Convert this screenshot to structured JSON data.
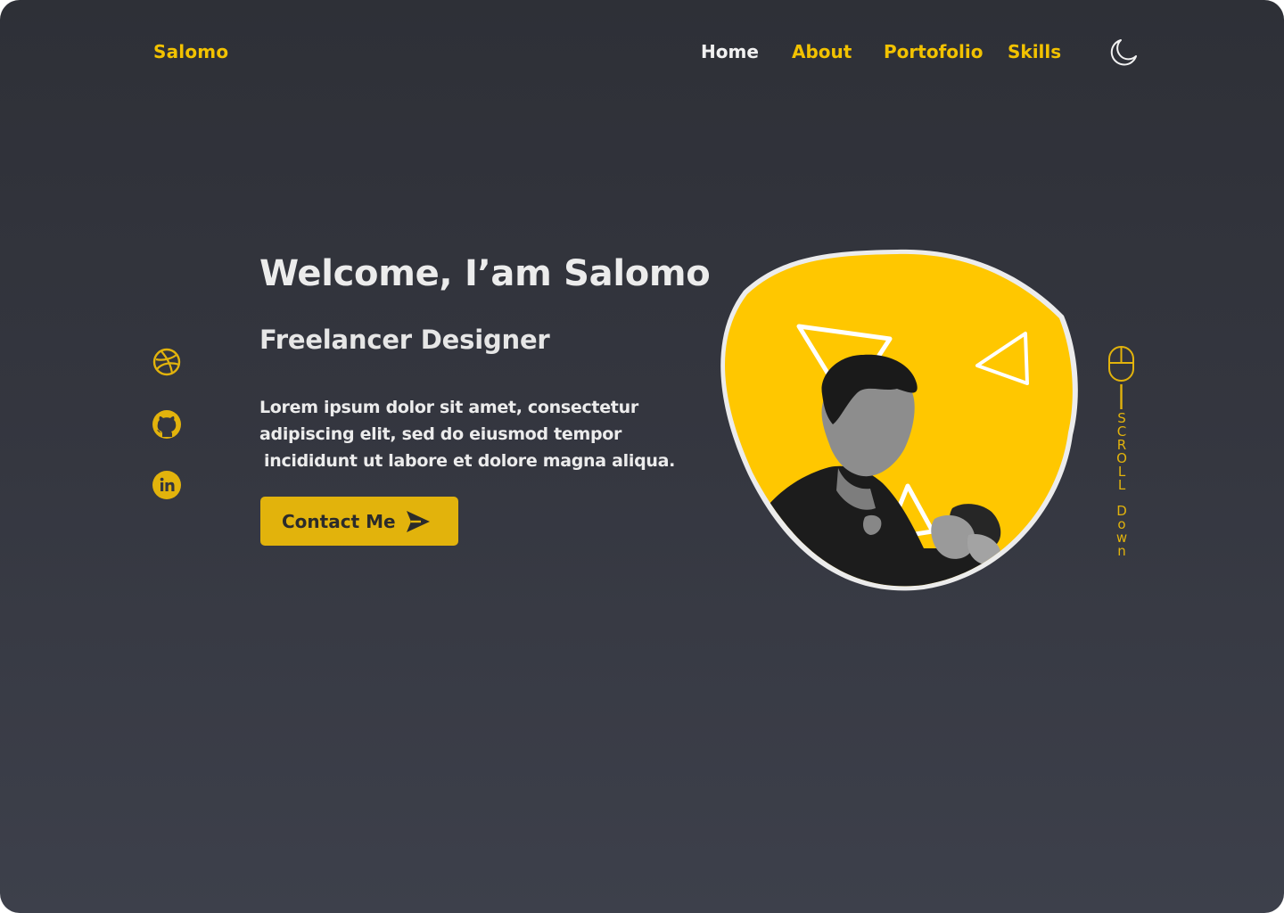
{
  "brand": "Salomo",
  "nav": {
    "home": "Home",
    "about": "About",
    "portfolio": "Portofolio",
    "skills": "Skills"
  },
  "icons": {
    "theme_toggle": "moon-icon",
    "social": [
      "dribbble-icon",
      "github-icon",
      "linkedin-icon"
    ],
    "cta": "send-icon",
    "scroll": "mouse-icon"
  },
  "hero": {
    "title": "Welcome, I’am Salomo",
    "subtitle": "Freelancer Designer",
    "description_lines": [
      "Lorem ipsum dolor sit amet, consectetur",
      "adipiscing elit, sed do eiusmod tempor",
      "incididunt ut labore et dolore magna aliqua."
    ],
    "cta_label": "Contact Me"
  },
  "scroll": {
    "word1": [
      "S",
      "C",
      "R",
      "O",
      "L",
      "L"
    ],
    "word2": [
      "D",
      "o",
      "w",
      "n"
    ]
  },
  "colors": {
    "accent": "#f2c200",
    "button": "#e2b30c",
    "background_top": "#2e3037",
    "background_bottom": "#3d404b",
    "blob": "#ffc700",
    "text": "#ececec"
  }
}
